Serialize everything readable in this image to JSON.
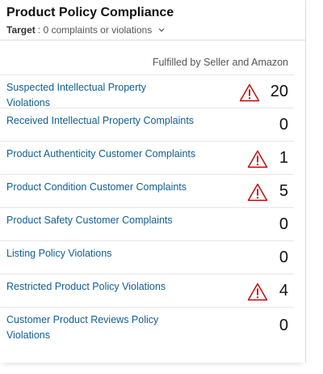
{
  "header": {
    "title": "Product Policy Compliance",
    "target_label": "Target",
    "target_value": ": 0 complaints or violations"
  },
  "subheading": "Fulfilled by Seller and Amazon",
  "colors": {
    "link": "#0f5e94",
    "warning": "#c40000"
  },
  "rows": [
    {
      "label": "Suspected Intellectual Property Violations",
      "count": "20",
      "warning": true
    },
    {
      "label": "Received Intellectual Property Complaints",
      "count": "0",
      "warning": false
    },
    {
      "label": "Product Authenticity Customer Complaints",
      "count": "1",
      "warning": true
    },
    {
      "label": "Product Condition Customer Complaints",
      "count": "5",
      "warning": true
    },
    {
      "label": "Product Safety Customer Complaints",
      "count": "0",
      "warning": false
    },
    {
      "label": "Listing Policy Violations",
      "count": "0",
      "warning": false
    },
    {
      "label": "Restricted Product Policy Violations",
      "count": "4",
      "warning": true
    },
    {
      "label": "Customer Product Reviews Policy Violations",
      "count": "0",
      "warning": false
    }
  ],
  "icons": {
    "warning": "warning-triangle-icon",
    "dropdown": "chevron-down-icon"
  }
}
